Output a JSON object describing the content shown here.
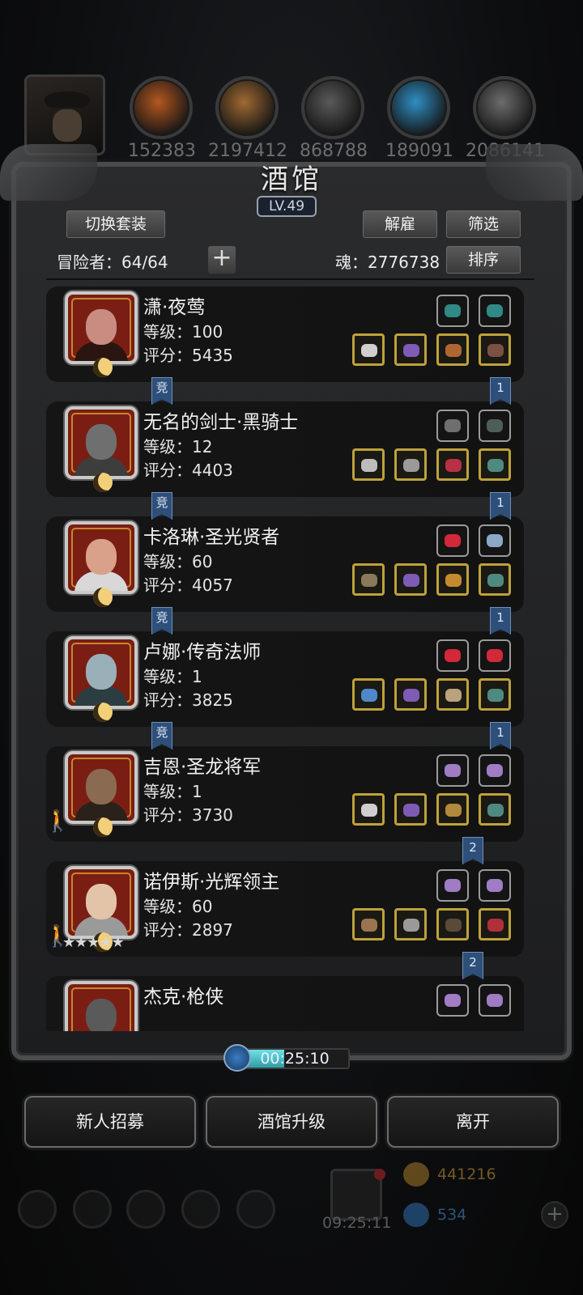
{
  "resources": [
    {
      "name": "meat",
      "value": "152383",
      "color": "#b4571f"
    },
    {
      "name": "wood",
      "value": "2197412",
      "color": "#a06a31"
    },
    {
      "name": "iron",
      "value": "868788",
      "color": "#5a5a5a"
    },
    {
      "name": "crystal",
      "value": "189091",
      "color": "#2f8fc4"
    },
    {
      "name": "steel",
      "value": "2086141",
      "color": "#6d6d6d"
    }
  ],
  "tavern": {
    "title": "酒馆",
    "level": "LV.49",
    "switch_outfit": "切换套装",
    "dismiss": "解雇",
    "filter": "筛选",
    "sort": "排序",
    "adventurers_label": "冒险者：64/64",
    "soul_label": "魂：2776738"
  },
  "heroes": [
    {
      "name": "潇·夜莺",
      "level": "等级：100",
      "score": "评分：5435",
      "tag_left": "竞",
      "tag_right": "1",
      "portrait": "nightingale",
      "head_color": "#c98c80",
      "body_color": "#2a1510",
      "gems": [
        "#2f8a86",
        "#2f8a86"
      ],
      "equip": [
        "#cfcfcf",
        "#7e5bb5",
        "#b06633",
        "#7b5144"
      ]
    },
    {
      "name": "无名的剑士·黑骑士",
      "level": "等级：12",
      "score": "评分：4403",
      "tag_left": "竞",
      "tag_right": "1",
      "portrait": "black-knight",
      "head_color": "#6f6f6f",
      "body_color": "#3d3d3d",
      "gems": [
        "#6f6f6f",
        "#4c5d5a"
      ],
      "equip": [
        "#bcbcbc",
        "#9a9a9a",
        "#b83044",
        "#4f8a80"
      ]
    },
    {
      "name": "卡洛琳·圣光贤者",
      "level": "等级：60",
      "score": "评分：4057",
      "tag_left": "竞",
      "tag_right": "1",
      "portrait": "caroline",
      "head_color": "#d9a08a",
      "body_color": "#d8d8d8",
      "gems": [
        "#d1283a",
        "#8aa7c7"
      ],
      "equip": [
        "#8a7a5a",
        "#7e5bb5",
        "#c58a2e",
        "#4f8a80"
      ]
    },
    {
      "name": "卢娜·传奇法师",
      "level": "等级：1",
      "score": "评分：3825",
      "tag_left": "竞",
      "tag_right": "1",
      "portrait": "luna",
      "head_color": "#9ab0b8",
      "body_color": "#2b3d40",
      "gems": [
        "#d1283a",
        "#d1283a"
      ],
      "equip": [
        "#4f88c8",
        "#7e5bb5",
        "#b9a27d",
        "#4f8a80"
      ]
    },
    {
      "name": "吉恩·圣龙将军",
      "level": "等级：1",
      "score": "评分：3730",
      "tag_left": "",
      "tag_right": "2",
      "portrait": "gene",
      "head_color": "#8a6a50",
      "body_color": "#2a211a",
      "gems": [
        "#a07cc4",
        "#a07cc4"
      ],
      "equip": [
        "#cfcfcf",
        "#7e5bb5",
        "#b08a3a",
        "#4f8a80"
      ]
    },
    {
      "name": "诺伊斯·光辉领主",
      "level": "等级：60",
      "score": "评分：2897",
      "tag_left": "",
      "tag_right": "2",
      "portrait": "noise",
      "head_color": "#e3c4a8",
      "body_color": "#9a9a9a",
      "stars": "★★★★★",
      "gems": [
        "#a07cc4",
        "#a07cc4"
      ],
      "equip": [
        "#9a7550",
        "#9a9a9a",
        "#5a4a3a",
        "#b0303a"
      ]
    },
    {
      "name": "杰克·枪侠",
      "level": "",
      "score": "",
      "tag_left": "",
      "tag_right": "",
      "portrait": "jack",
      "head_color": "#5a5a5a",
      "body_color": "#3a3a3a",
      "gems": [
        "#a07cc4",
        "#a07cc4"
      ],
      "equip": []
    }
  ],
  "timer": {
    "text": "00:25:10",
    "progress": 0.4
  },
  "bottom_buttons": [
    "新人招募",
    "酒馆升级",
    "离开"
  ],
  "background_hud": {
    "gift_timer": "09:25:11",
    "gold": "441216",
    "gems": "534"
  }
}
